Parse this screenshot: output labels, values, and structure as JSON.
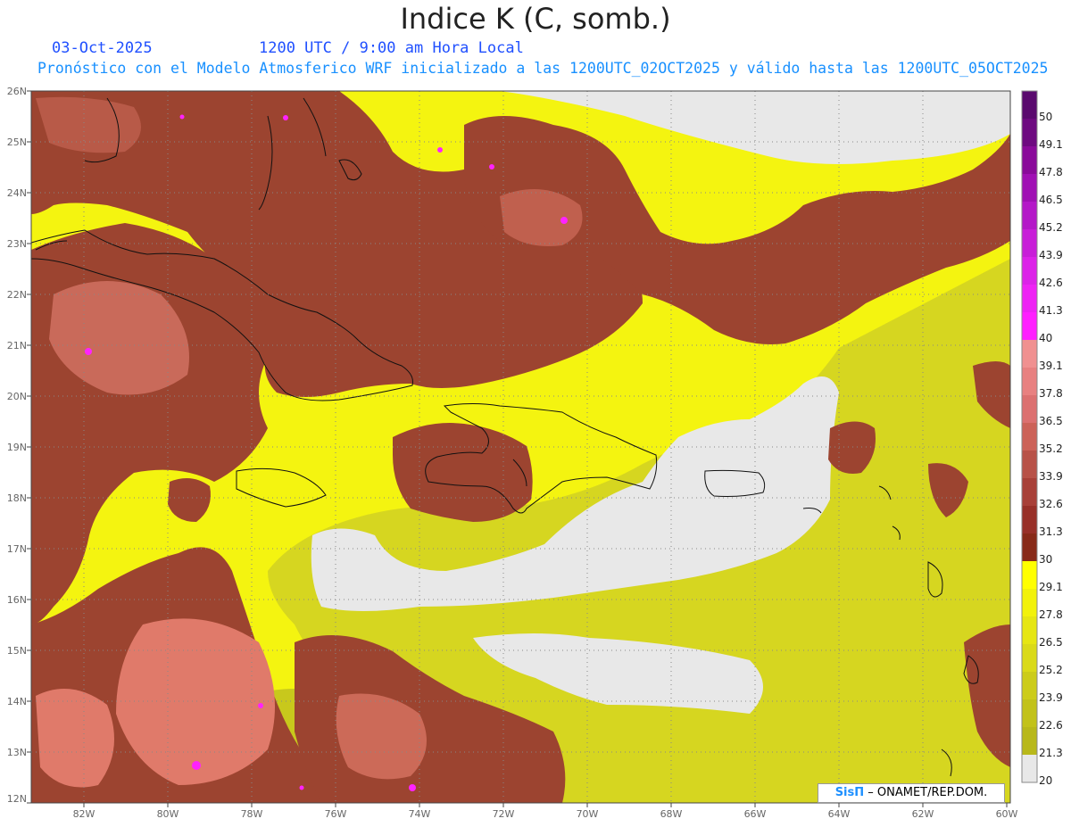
{
  "title": "Indice K (C, somb.)",
  "subtitle_date": "03-Oct-2025",
  "subtitle_time": "1200 UTC / 9:00 am Hora Local",
  "forecast_text": "Pronóstico con el Modelo Atmosferico WRF inicializado a las 1200UTC_02OCT2025 y válido hasta las  1200UTC_05OCT2025",
  "lat_labels": [
    "26N",
    "25N",
    "24N",
    "23N",
    "22N",
    "21N",
    "20N",
    "19N",
    "18N",
    "17N",
    "16N",
    "15N",
    "14N",
    "13N",
    "12N"
  ],
  "lon_labels": [
    "82W",
    "80W",
    "78W",
    "76W",
    "74W",
    "72W",
    "70W",
    "68W",
    "66W",
    "64W",
    "62W",
    "60W"
  ],
  "colorbar": {
    "labels": [
      "50",
      "49.1",
      "47.8",
      "46.5",
      "45.2",
      "43.9",
      "42.6",
      "41.3",
      "40",
      "39.1",
      "37.8",
      "36.5",
      "35.2",
      "33.9",
      "32.6",
      "31.3",
      "30",
      "29.1",
      "27.8",
      "26.5",
      "25.2",
      "23.9",
      "22.6",
      "21.3",
      "20"
    ],
    "colors": [
      "#5a0a6e",
      "#6e0a80",
      "#8a0a9a",
      "#a010b4",
      "#b418c8",
      "#c81ed8",
      "#dc22e8",
      "#ee22f4",
      "#ff20ff",
      "#f09090",
      "#e88080",
      "#dc7070",
      "#cc6258",
      "#b85248",
      "#a84038",
      "#983028",
      "#882a18",
      "#ffff00",
      "#f2f20a",
      "#e6e612",
      "#dada18",
      "#cccc1a",
      "#c2c21a",
      "#b8b81a",
      "#e8e8e8"
    ],
    "below_label": "20"
  },
  "colors": {
    "ocean_gray": "#e8e8e8",
    "yellow": "#f4f410",
    "olive": "#d6d620",
    "dark_red": "#9c4430",
    "salmon": "#e07a6a",
    "magenta": "#ff22ff"
  },
  "credit": {
    "logo": "SisΠ",
    "text": "– ONAMET/REP.DOM."
  }
}
